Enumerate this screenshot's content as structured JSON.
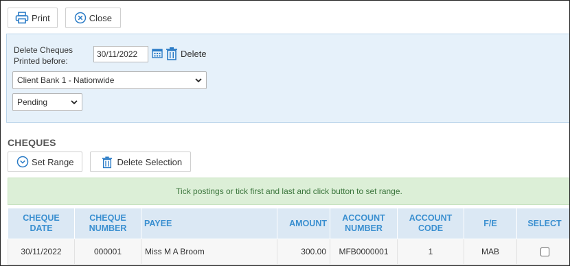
{
  "toolbar": {
    "print_label": "Print",
    "close_label": "Close"
  },
  "filter": {
    "label": "Delete Cheques Printed before:",
    "date_value": "30/11/2022",
    "delete_label": "Delete",
    "bank_selected": "Client Bank 1 - Nationwide",
    "status_selected": "Pending"
  },
  "cheques": {
    "title": "CHEQUES",
    "set_range_label": "Set Range",
    "delete_selection_label": "Delete Selection",
    "info_text": "Tick postings or tick first and last and click button to set range.",
    "columns": [
      "CHEQUE DATE",
      "CHEQUE NUMBER",
      "PAYEE",
      "AMOUNT",
      "ACCOUNT NUMBER",
      "ACCOUNT CODE",
      "F/E",
      "SELECT"
    ],
    "rows": [
      {
        "date": "30/11/2022",
        "number": "000001",
        "payee": "Miss M A Broom",
        "amount": "300.00",
        "account_number": "MFB0000001",
        "account_code": "1",
        "fe": "MAB"
      }
    ]
  },
  "colors": {
    "accent_blue": "#3a8fd0",
    "panel_bg": "#e6f1fa",
    "info_bg": "#dcefd7",
    "info_text": "#3c763d"
  },
  "icons": [
    "printer-icon",
    "close-circle-icon",
    "calendar-icon",
    "trash-icon",
    "chevron-down-circle-icon",
    "chevron-down-icon"
  ]
}
